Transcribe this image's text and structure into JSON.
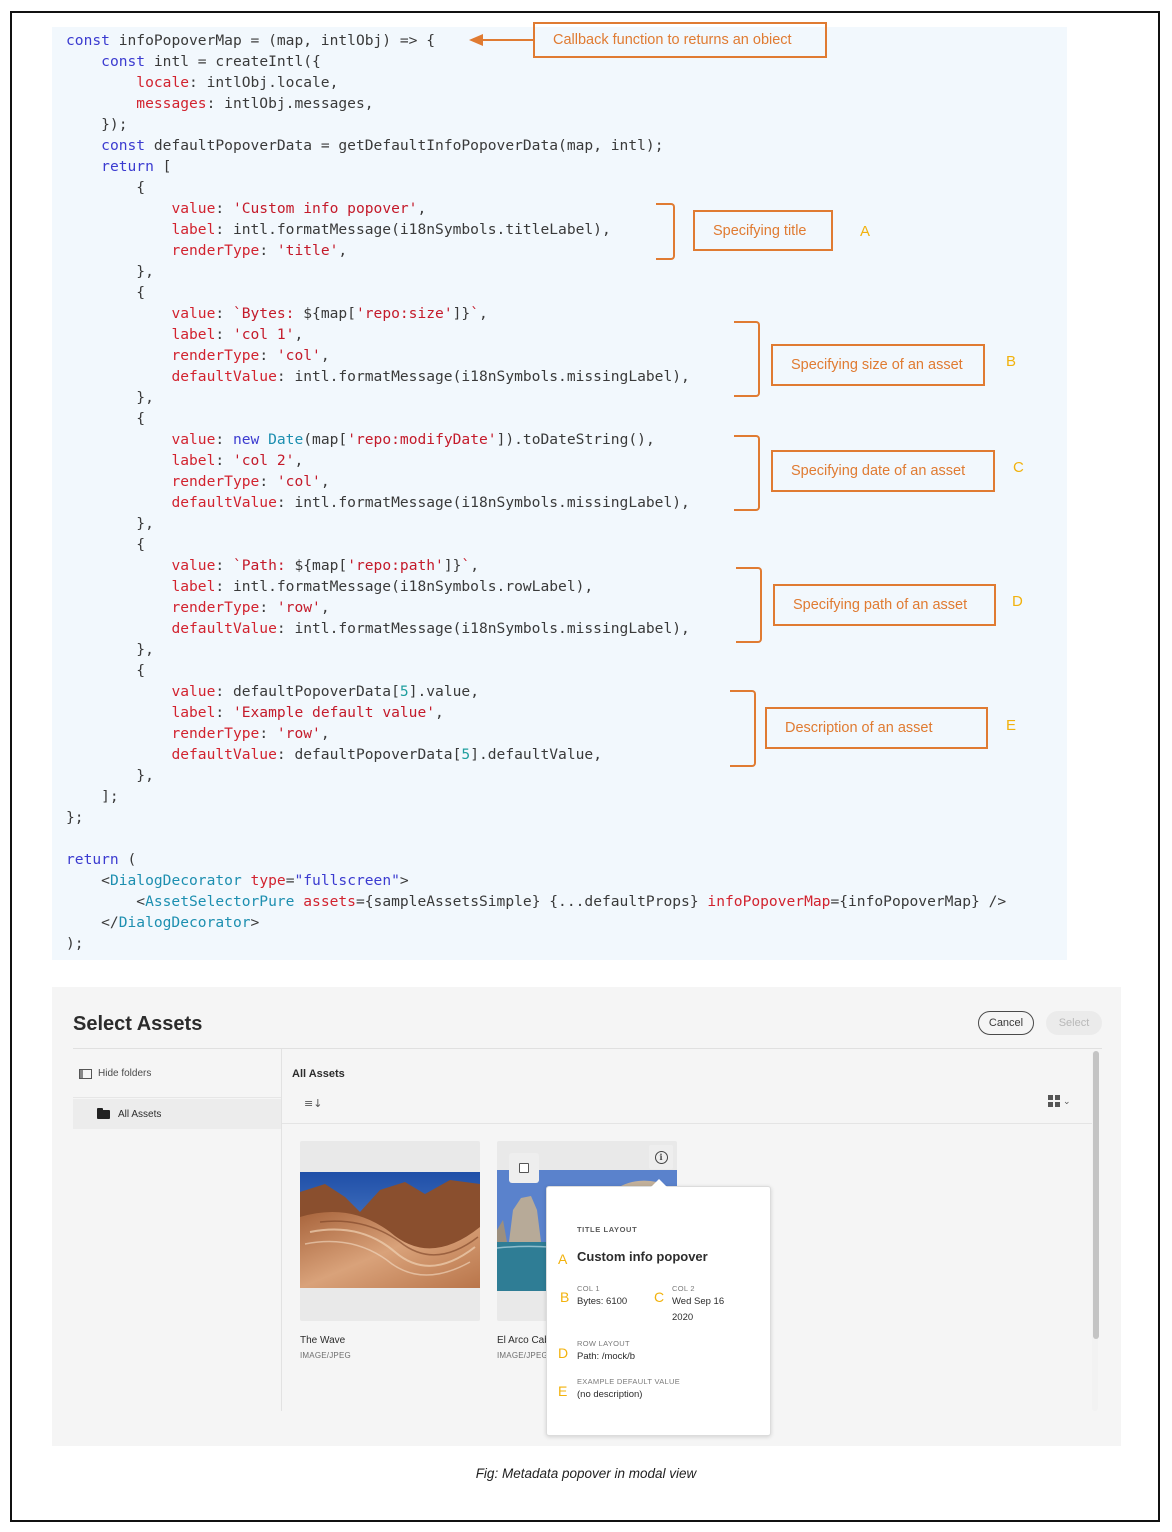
{
  "code": {
    "lines": [
      [
        {
          "t": "kw",
          "v": "const"
        },
        {
          "t": "txt",
          "v": " infoPopoverMap = (map, intlObj) => {"
        }
      ],
      [
        {
          "t": "txt",
          "v": "    "
        },
        {
          "t": "kw",
          "v": "const"
        },
        {
          "t": "txt",
          "v": " intl = createIntl({"
        }
      ],
      [
        {
          "t": "txt",
          "v": "        "
        },
        {
          "t": "prop",
          "v": "locale"
        },
        {
          "t": "txt",
          "v": ": intlObj.locale,"
        }
      ],
      [
        {
          "t": "txt",
          "v": "        "
        },
        {
          "t": "prop",
          "v": "messages"
        },
        {
          "t": "txt",
          "v": ": intlObj.messages,"
        }
      ],
      [
        {
          "t": "txt",
          "v": "    });"
        }
      ],
      [
        {
          "t": "txt",
          "v": "    "
        },
        {
          "t": "kw",
          "v": "const"
        },
        {
          "t": "txt",
          "v": " defaultPopoverData = getDefaultInfoPopoverData(map, intl);"
        }
      ],
      [
        {
          "t": "txt",
          "v": "    "
        },
        {
          "t": "kw",
          "v": "return"
        },
        {
          "t": "txt",
          "v": " ["
        }
      ],
      [
        {
          "t": "txt",
          "v": "        {"
        }
      ],
      [
        {
          "t": "txt",
          "v": "            "
        },
        {
          "t": "prop",
          "v": "value"
        },
        {
          "t": "txt",
          "v": ": "
        },
        {
          "t": "str",
          "v": "'Custom info popover'"
        },
        {
          "t": "txt",
          "v": ","
        }
      ],
      [
        {
          "t": "txt",
          "v": "            "
        },
        {
          "t": "prop",
          "v": "label"
        },
        {
          "t": "txt",
          "v": ": intl.formatMessage(i18nSymbols.titleLabel),"
        }
      ],
      [
        {
          "t": "txt",
          "v": "            "
        },
        {
          "t": "prop",
          "v": "renderType"
        },
        {
          "t": "txt",
          "v": ": "
        },
        {
          "t": "str",
          "v": "'title'"
        },
        {
          "t": "txt",
          "v": ","
        }
      ],
      [
        {
          "t": "txt",
          "v": "        },"
        }
      ],
      [
        {
          "t": "txt",
          "v": "        {"
        }
      ],
      [
        {
          "t": "txt",
          "v": "            "
        },
        {
          "t": "prop",
          "v": "value"
        },
        {
          "t": "txt",
          "v": ": "
        },
        {
          "t": "str",
          "v": "`Bytes: "
        },
        {
          "t": "txt",
          "v": "${map["
        },
        {
          "t": "str",
          "v": "'repo:size'"
        },
        {
          "t": "txt",
          "v": "]}"
        },
        {
          "t": "str",
          "v": "`"
        },
        {
          "t": "txt",
          "v": ","
        }
      ],
      [
        {
          "t": "txt",
          "v": "            "
        },
        {
          "t": "prop",
          "v": "label"
        },
        {
          "t": "txt",
          "v": ": "
        },
        {
          "t": "str",
          "v": "'col 1'"
        },
        {
          "t": "txt",
          "v": ","
        }
      ],
      [
        {
          "t": "txt",
          "v": "            "
        },
        {
          "t": "prop",
          "v": "renderType"
        },
        {
          "t": "txt",
          "v": ": "
        },
        {
          "t": "str",
          "v": "'col'"
        },
        {
          "t": "txt",
          "v": ","
        }
      ],
      [
        {
          "t": "txt",
          "v": "            "
        },
        {
          "t": "prop",
          "v": "defaultValue"
        },
        {
          "t": "txt",
          "v": ": intl.formatMessage(i18nSymbols.missingLabel),"
        }
      ],
      [
        {
          "t": "txt",
          "v": "        },"
        }
      ],
      [
        {
          "t": "txt",
          "v": "        {"
        }
      ],
      [
        {
          "t": "txt",
          "v": "            "
        },
        {
          "t": "prop",
          "v": "value"
        },
        {
          "t": "txt",
          "v": ": "
        },
        {
          "t": "kw",
          "v": "new"
        },
        {
          "t": "txt",
          "v": " "
        },
        {
          "t": "tag",
          "v": "Date"
        },
        {
          "t": "txt",
          "v": "(map["
        },
        {
          "t": "str",
          "v": "'repo:modifyDate'"
        },
        {
          "t": "txt",
          "v": "]).toDateString(),"
        }
      ],
      [
        {
          "t": "txt",
          "v": "            "
        },
        {
          "t": "prop",
          "v": "label"
        },
        {
          "t": "txt",
          "v": ": "
        },
        {
          "t": "str",
          "v": "'col 2'"
        },
        {
          "t": "txt",
          "v": ","
        }
      ],
      [
        {
          "t": "txt",
          "v": "            "
        },
        {
          "t": "prop",
          "v": "renderType"
        },
        {
          "t": "txt",
          "v": ": "
        },
        {
          "t": "str",
          "v": "'col'"
        },
        {
          "t": "txt",
          "v": ","
        }
      ],
      [
        {
          "t": "txt",
          "v": "            "
        },
        {
          "t": "prop",
          "v": "defaultValue"
        },
        {
          "t": "txt",
          "v": ": intl.formatMessage(i18nSymbols.missingLabel),"
        }
      ],
      [
        {
          "t": "txt",
          "v": "        },"
        }
      ],
      [
        {
          "t": "txt",
          "v": "        {"
        }
      ],
      [
        {
          "t": "txt",
          "v": "            "
        },
        {
          "t": "prop",
          "v": "value"
        },
        {
          "t": "txt",
          "v": ": "
        },
        {
          "t": "str",
          "v": "`Path: "
        },
        {
          "t": "txt",
          "v": "${map["
        },
        {
          "t": "str",
          "v": "'repo:path'"
        },
        {
          "t": "txt",
          "v": "]}"
        },
        {
          "t": "str",
          "v": "`"
        },
        {
          "t": "txt",
          "v": ","
        }
      ],
      [
        {
          "t": "txt",
          "v": "            "
        },
        {
          "t": "prop",
          "v": "label"
        },
        {
          "t": "txt",
          "v": ": intl.formatMessage(i18nSymbols.rowLabel),"
        }
      ],
      [
        {
          "t": "txt",
          "v": "            "
        },
        {
          "t": "prop",
          "v": "renderType"
        },
        {
          "t": "txt",
          "v": ": "
        },
        {
          "t": "str",
          "v": "'row'"
        },
        {
          "t": "txt",
          "v": ","
        }
      ],
      [
        {
          "t": "txt",
          "v": "            "
        },
        {
          "t": "prop",
          "v": "defaultValue"
        },
        {
          "t": "txt",
          "v": ": intl.formatMessage(i18nSymbols.missingLabel),"
        }
      ],
      [
        {
          "t": "txt",
          "v": "        },"
        }
      ],
      [
        {
          "t": "txt",
          "v": "        {"
        }
      ],
      [
        {
          "t": "txt",
          "v": "            "
        },
        {
          "t": "prop",
          "v": "value"
        },
        {
          "t": "txt",
          "v": ": defaultPopoverData["
        },
        {
          "t": "num",
          "v": "5"
        },
        {
          "t": "txt",
          "v": "].value,"
        }
      ],
      [
        {
          "t": "txt",
          "v": "            "
        },
        {
          "t": "prop",
          "v": "label"
        },
        {
          "t": "txt",
          "v": ": "
        },
        {
          "t": "str",
          "v": "'Example default value'"
        },
        {
          "t": "txt",
          "v": ","
        }
      ],
      [
        {
          "t": "txt",
          "v": "            "
        },
        {
          "t": "prop",
          "v": "renderType"
        },
        {
          "t": "txt",
          "v": ": "
        },
        {
          "t": "str",
          "v": "'row'"
        },
        {
          "t": "txt",
          "v": ","
        }
      ],
      [
        {
          "t": "txt",
          "v": "            "
        },
        {
          "t": "prop",
          "v": "defaultValue"
        },
        {
          "t": "txt",
          "v": ": defaultPopoverData["
        },
        {
          "t": "num",
          "v": "5"
        },
        {
          "t": "txt",
          "v": "].defaultValue,"
        }
      ],
      [
        {
          "t": "txt",
          "v": "        },"
        }
      ],
      [
        {
          "t": "txt",
          "v": "    ];"
        }
      ],
      [
        {
          "t": "txt",
          "v": "};"
        }
      ],
      [
        {
          "t": "txt",
          "v": ""
        }
      ],
      [
        {
          "t": "kw",
          "v": "return"
        },
        {
          "t": "txt",
          "v": " ("
        }
      ],
      [
        {
          "t": "txt",
          "v": "    <"
        },
        {
          "t": "tag",
          "v": "DialogDecorator"
        },
        {
          "t": "txt",
          "v": " "
        },
        {
          "t": "prop",
          "v": "type"
        },
        {
          "t": "txt",
          "v": "="
        },
        {
          "t": "kw",
          "v": "\"fullscreen\""
        },
        {
          "t": "txt",
          "v": ">"
        }
      ],
      [
        {
          "t": "txt",
          "v": "        <"
        },
        {
          "t": "tag",
          "v": "AssetSelectorPure"
        },
        {
          "t": "txt",
          "v": " "
        },
        {
          "t": "prop",
          "v": "assets"
        },
        {
          "t": "txt",
          "v": "={sampleAssetsSimple} {...defaultProps} "
        },
        {
          "t": "prop",
          "v": "infoPopoverMap"
        },
        {
          "t": "txt",
          "v": "={infoPopoverMap} />"
        }
      ],
      [
        {
          "t": "txt",
          "v": "    </"
        },
        {
          "t": "tag",
          "v": "DialogDecorator"
        },
        {
          "t": "txt",
          "v": ">"
        }
      ],
      [
        {
          "t": "txt",
          "v": ");"
        }
      ]
    ]
  },
  "annotations": {
    "callback": "Callback function to returns an obiect",
    "items": [
      {
        "letter": "A",
        "text": "Specifying title"
      },
      {
        "letter": "B",
        "text": "Specifying size of an asset"
      },
      {
        "letter": "C",
        "text": "Specifying date of an asset"
      },
      {
        "letter": "D",
        "text": "Specifying path of an asset"
      },
      {
        "letter": "E",
        "text": "Description of an asset"
      }
    ]
  },
  "modal": {
    "title": "Select Assets",
    "cancel_label": "Cancel",
    "select_label": "Select",
    "sidebar": {
      "hide_folders_label": "Hide folders",
      "folder_label": "All Assets"
    },
    "content": {
      "title": "All Assets",
      "sort_icon": "≡↓",
      "view_chevron": "⌄"
    },
    "cards": [
      {
        "name": "The Wave",
        "type": "IMAGE/JPEG"
      },
      {
        "name": "El Arco Cab",
        "type": "IMAGE/JPEG"
      }
    ],
    "popover": {
      "section_title": "TITLE LAYOUT",
      "title": "Custom info popover",
      "col1_label": "COL 1",
      "col1_value": "Bytes: 6100",
      "col2_label": "COL 2",
      "col2_value_line1": "Wed Sep 16",
      "col2_value_line2": "2020",
      "row_label": "ROW LAYOUT",
      "row_value": "Path: /mock/b",
      "example_label": "EXAMPLE DEFAULT VALUE",
      "example_value": "(no description)",
      "letters": [
        "A",
        "B",
        "C",
        "D",
        "E"
      ]
    }
  },
  "caption": "Fig: Metadata popover in modal view",
  "colors": {
    "annotation": "#e07b32",
    "annotation_letter": "#f2b20d",
    "code_background": "#f2f8fd",
    "keyword": "#3b3bd0",
    "property": "#d2232f"
  }
}
